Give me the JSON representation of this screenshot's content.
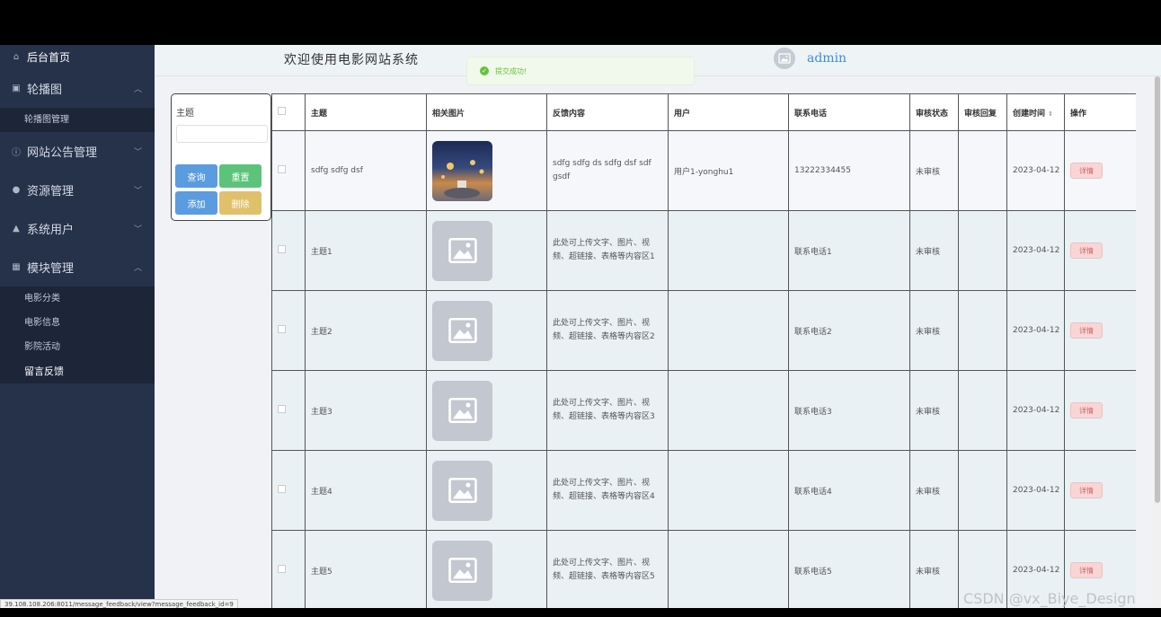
{
  "sidebar": {
    "home": "后台首页",
    "menu": [
      {
        "label": "轮播图",
        "icon": "image-icon",
        "chevron": "︿"
      },
      {
        "label": "网站公告管理",
        "icon": "info-icon",
        "chevron": "﹀"
      },
      {
        "label": "资源管理",
        "icon": "location-icon",
        "chevron": "﹀"
      },
      {
        "label": "系统用户",
        "icon": "user-icon",
        "chevron": "﹀"
      },
      {
        "label": "模块管理",
        "icon": "grid-icon",
        "chevron": "︿"
      }
    ],
    "carousel_sub": [
      "轮播图管理"
    ],
    "module_sub": [
      "电影分类",
      "电影信息",
      "影院活动",
      "留言反馈"
    ]
  },
  "topbar": {
    "title": "欢迎使用电影网站系统",
    "user": "admin"
  },
  "toast": {
    "message": "提交成功!"
  },
  "search": {
    "label": "主题",
    "input_value": "",
    "query_label": "查询",
    "reset_label": "重置",
    "add_label": "添加",
    "delete_label": "删除"
  },
  "table": {
    "headers": [
      "主题",
      "相关图片",
      "反馈内容",
      "用户",
      "联系电话",
      "审核状态",
      "审核回复",
      "创建时间",
      "操作"
    ],
    "detail_label": "详情",
    "rows": [
      {
        "subject": "sdfg sdfg dsf",
        "content": "sdfg sdfg ds sdfg dsf sdf gsdf",
        "user": "用户1-yonghu1",
        "phone": "13222334455",
        "status": "未审核",
        "reply": "",
        "created": "2023-04-12"
      },
      {
        "subject": "主题1",
        "content": "此处可上传文字、图片、视频、超链接、表格等内容区1",
        "user": "",
        "phone": "联系电话1",
        "status": "未审核",
        "reply": "",
        "created": "2023-04-12"
      },
      {
        "subject": "主题2",
        "content": "此处可上传文字、图片、视频、超链接、表格等内容区2",
        "user": "",
        "phone": "联系电话2",
        "status": "未审核",
        "reply": "",
        "created": "2023-04-12"
      },
      {
        "subject": "主题3",
        "content": "此处可上传文字、图片、视频、超链接、表格等内容区3",
        "user": "",
        "phone": "联系电话3",
        "status": "未审核",
        "reply": "",
        "created": "2023-04-12"
      },
      {
        "subject": "主题4",
        "content": "此处可上传文字、图片、视频、超链接、表格等内容区4",
        "user": "",
        "phone": "联系电话4",
        "status": "未审核",
        "reply": "",
        "created": "2023-04-12"
      },
      {
        "subject": "主题5",
        "content": "此处可上传文字、图片、视频、超链接、表格等内容区5",
        "user": "",
        "phone": "联系电话5",
        "status": "未审核",
        "reply": "",
        "created": "2023-04-12"
      }
    ]
  },
  "statusbar": {
    "url": "39.108.108.206:8011/message_feedback/view?message_feedback_id=9"
  },
  "watermark": "CSDN @vx_Biye_Design",
  "colors": {
    "sidebar": "#26324a",
    "query": "#5b9be0",
    "reset": "#5cc47a",
    "add": "#5b9be0",
    "delete": "#e0c06a",
    "toast": "#67c23a"
  }
}
